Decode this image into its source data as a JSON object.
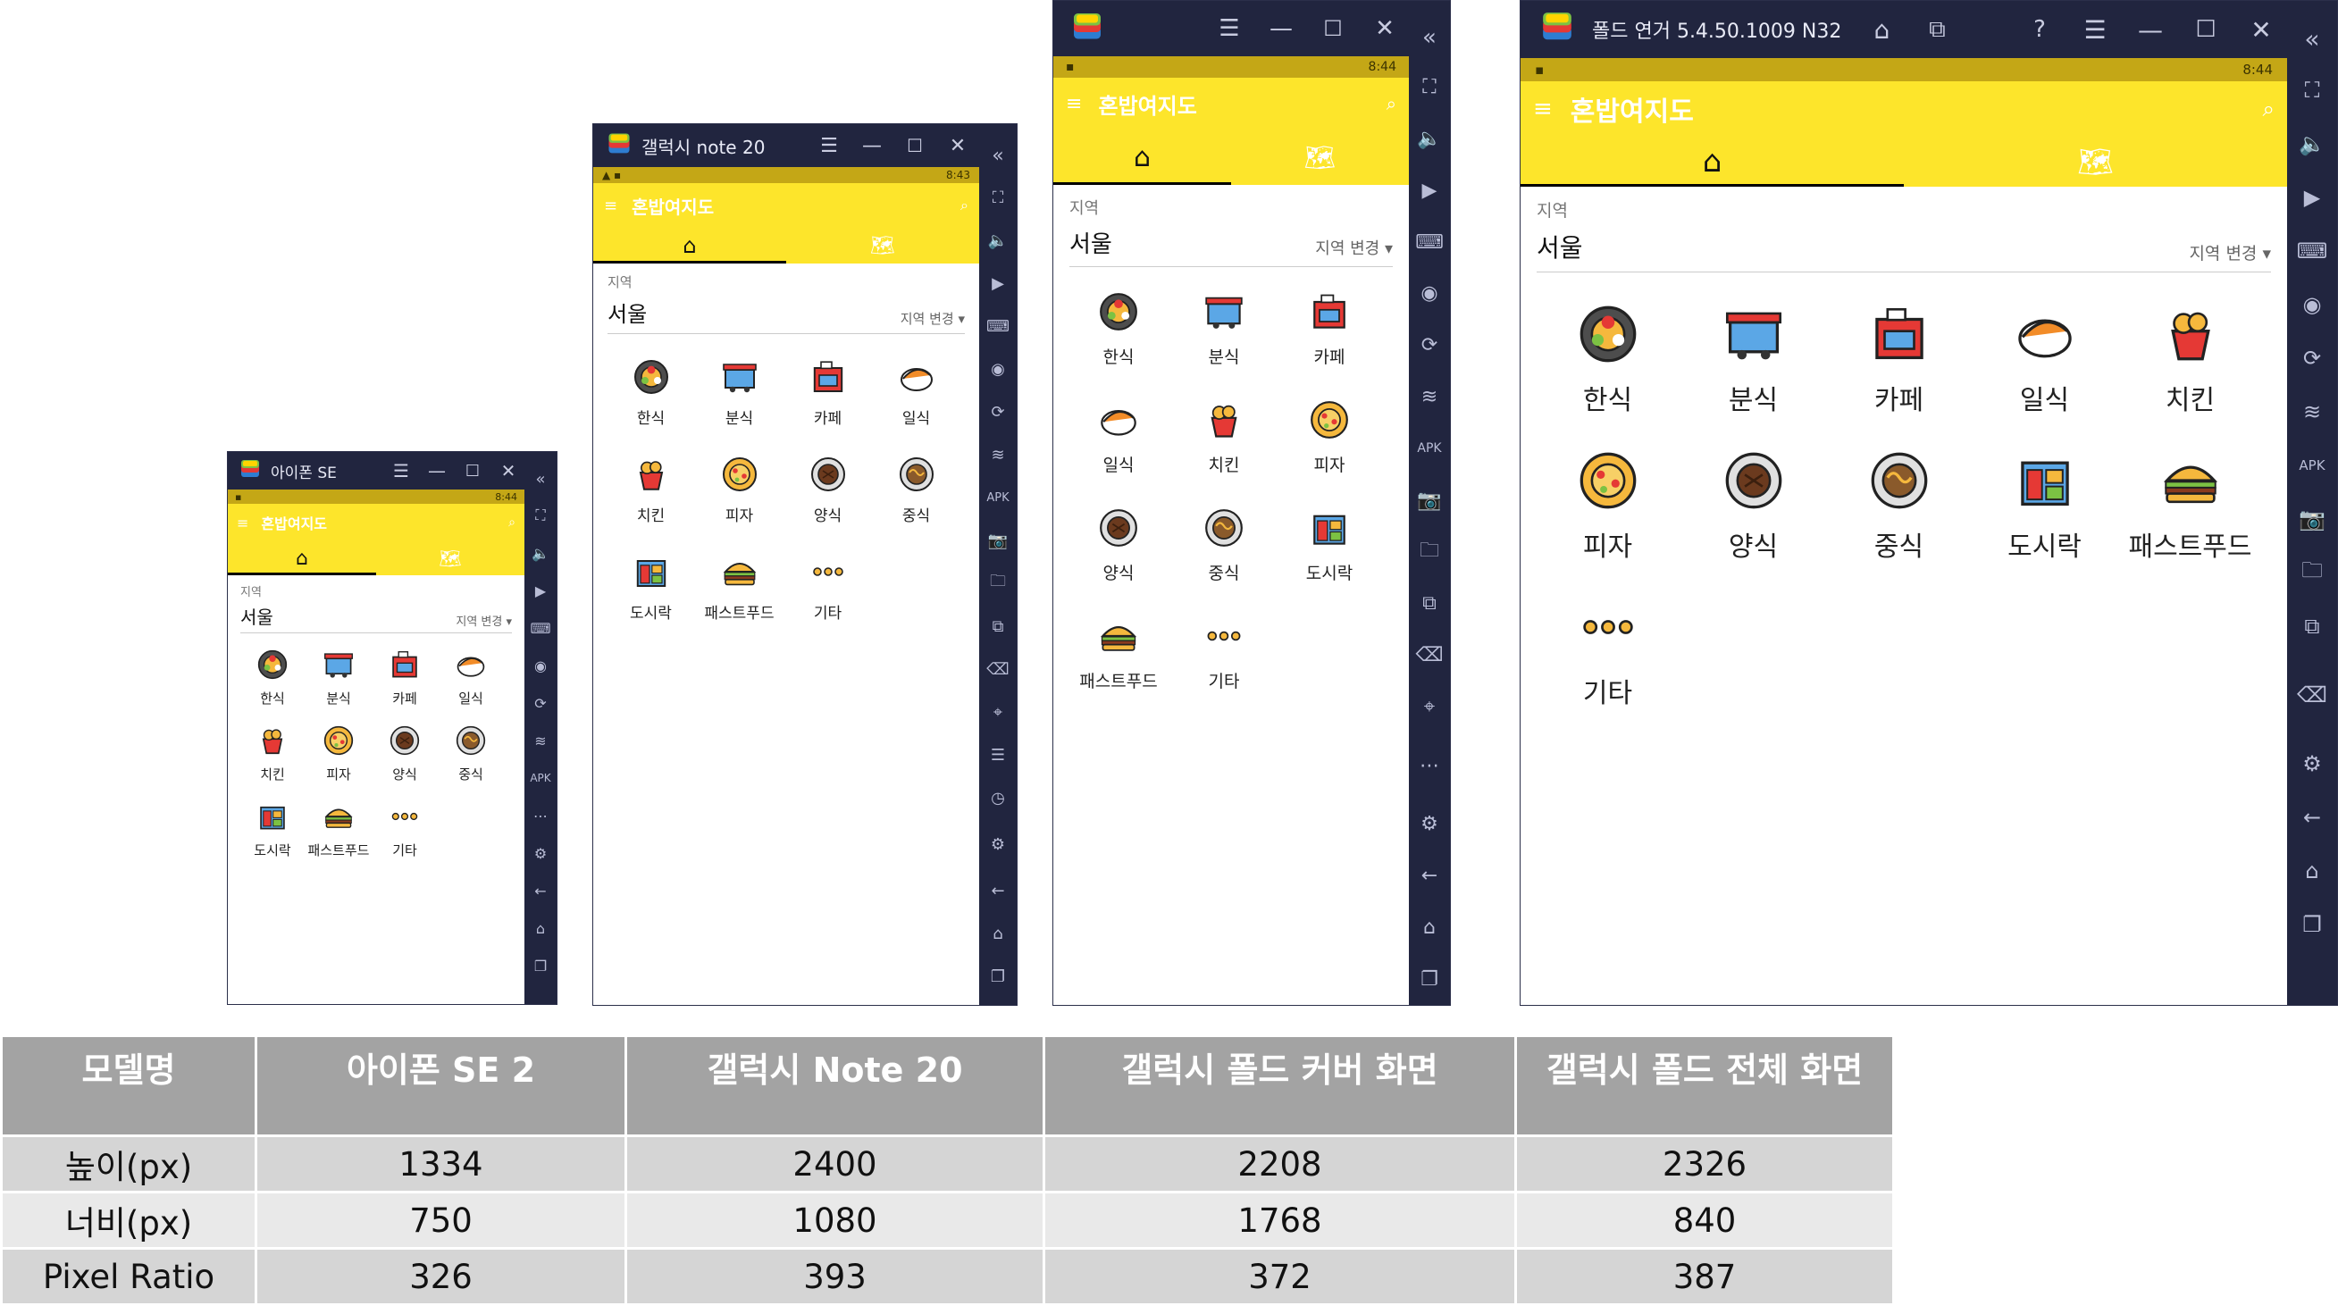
{
  "app": {
    "status_time": [
      "8:44",
      "8:43",
      "8:44",
      "8:44"
    ],
    "title": "혼밥여지도",
    "region_label": "지역",
    "region_value": "서울",
    "region_change": "지역 변경 ▾",
    "categories": [
      "한식",
      "분식",
      "카페",
      "일식",
      "치킨",
      "피자",
      "양식",
      "중식",
      "도시락",
      "패스트푸드",
      "기타"
    ],
    "categories_cover": [
      "한식",
      "분식",
      "카페",
      "일식",
      "치킨",
      "피자",
      "양식",
      "중식",
      "도시락",
      "패스트푸드",
      "기타"
    ]
  },
  "windows": {
    "w1_title": "아이폰 SE",
    "w2_title": "갤럭시 note 20",
    "w3_title": "",
    "w4_title": "폴드 연거 5.4.50.1009 N32"
  },
  "colors": {
    "accent": "#fde52b",
    "status": "#c4a716",
    "frame": "#21253f"
  },
  "table": {
    "headers": [
      "모델명",
      "아이폰 SE 2",
      "갤럭시 Note 20",
      "갤럭시 폴드 커버 화면",
      "갤럭시 폴드 전체 화면"
    ],
    "rows": [
      [
        "높이(px)",
        "1334",
        "2400",
        "2208",
        "2326"
      ],
      [
        "너비(px)",
        "750",
        "1080",
        "1768",
        "840"
      ],
      [
        "Pixel Ratio",
        "326",
        "393",
        "372",
        "387"
      ]
    ]
  }
}
